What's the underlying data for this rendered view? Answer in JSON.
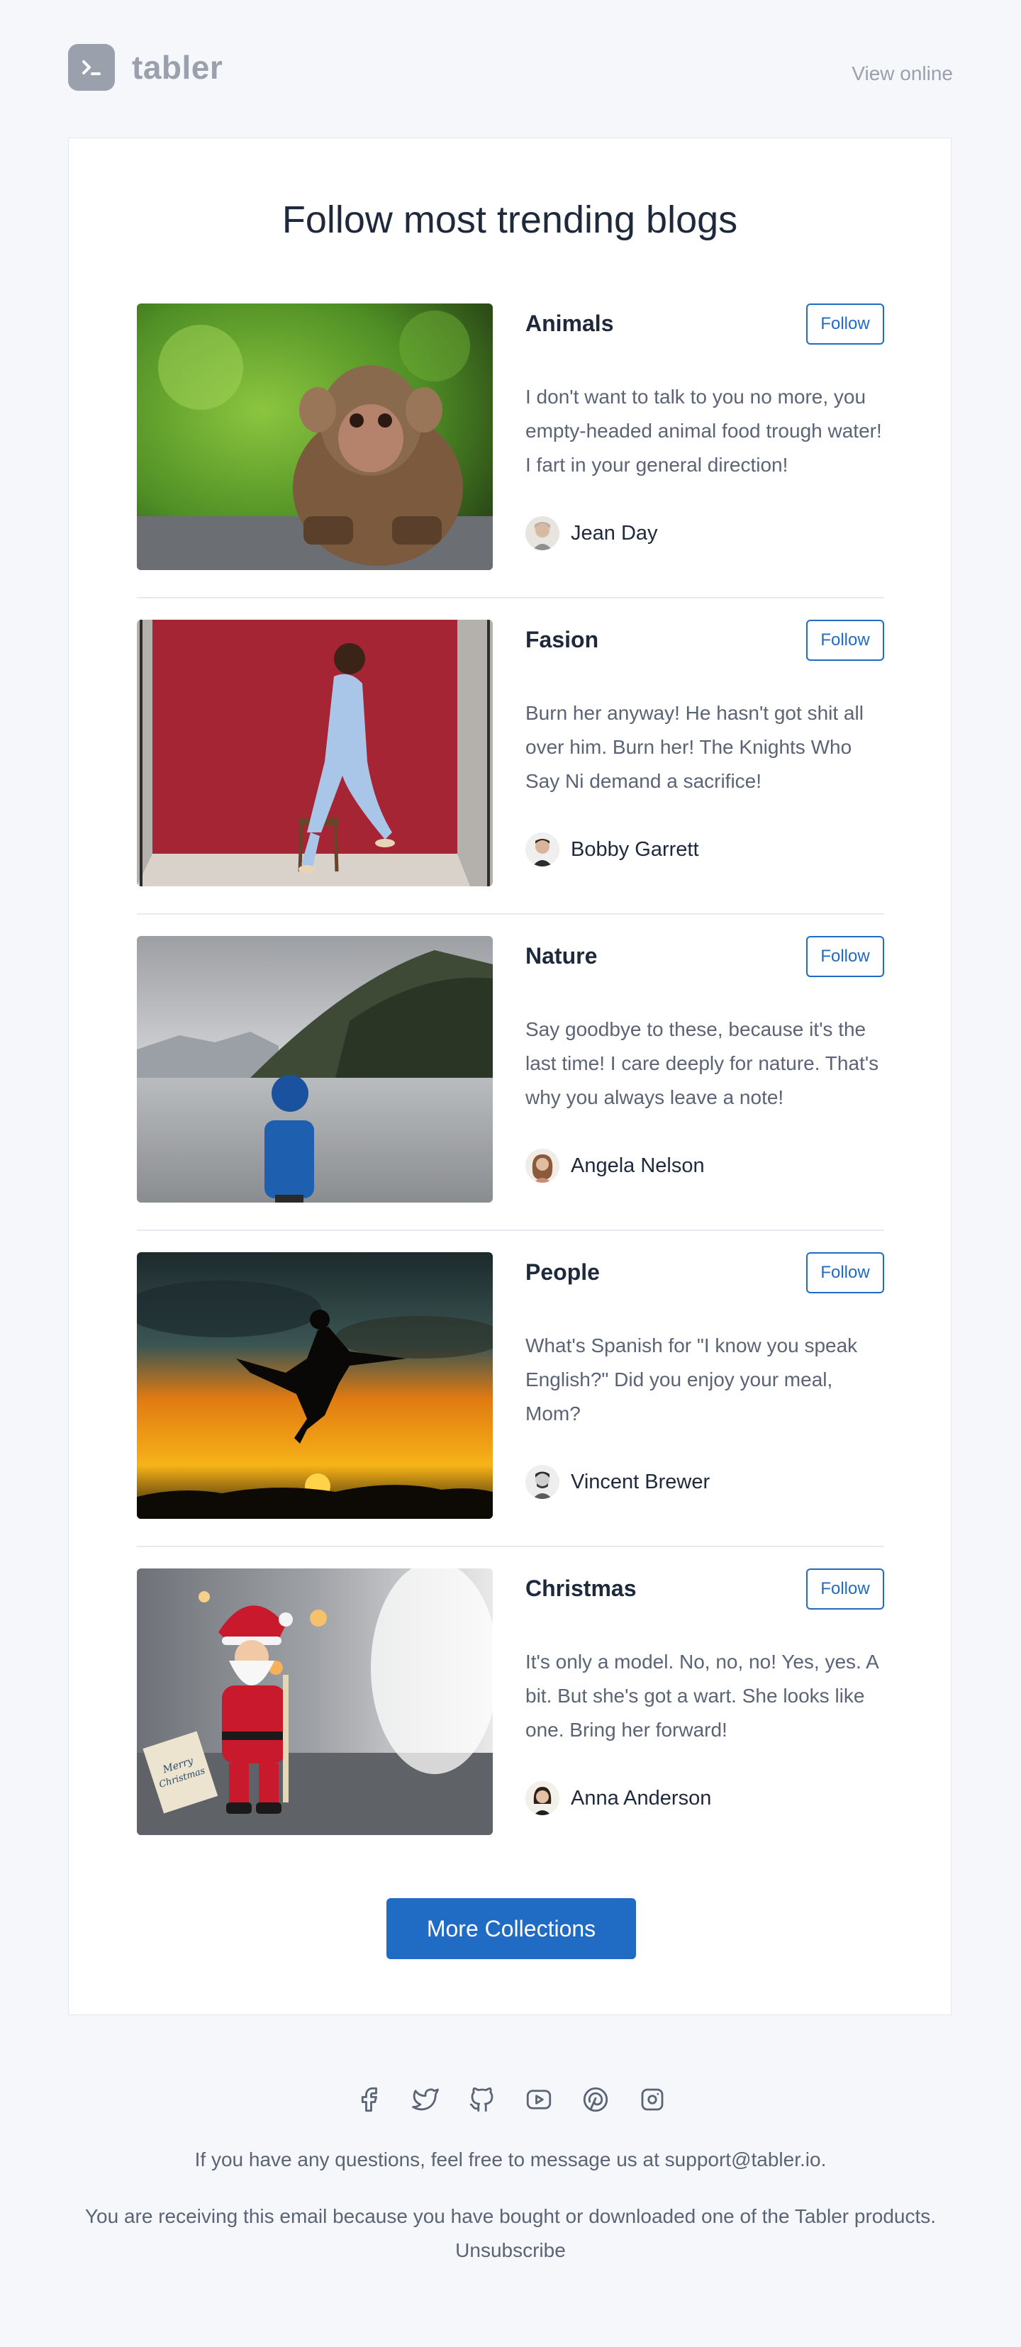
{
  "header": {
    "brand": "tabler",
    "view_online": "View online"
  },
  "main": {
    "title": "Follow most trending blogs",
    "blogs": [
      {
        "title": "Animals",
        "follow_label": "Follow",
        "description": "I don't want to talk to you no more, you empty-headed animal food trough water! I fart in your general direction!",
        "author": "Jean Day",
        "image": "monkey-photo"
      },
      {
        "title": "Fasion",
        "follow_label": "Follow",
        "description": "Burn her anyway! He hasn't got shit all over him. Burn her! The Knights Who Say Ni demand a sacrifice!",
        "author": "Bobby Garrett",
        "image": "fashion-model-photo"
      },
      {
        "title": "Nature",
        "follow_label": "Follow",
        "description": "Say goodbye to these, because it's the last time! I care deeply for nature. That's why you always leave a note!",
        "author": "Angela Nelson",
        "image": "lake-person-photo"
      },
      {
        "title": "People",
        "follow_label": "Follow",
        "description": "What's Spanish for \"I know you speak English?\" Did you enjoy your meal, Mom?",
        "author": "Vincent Brewer",
        "image": "sunset-kick-photo"
      },
      {
        "title": "Christmas",
        "follow_label": "Follow",
        "description": "It's only a model. No, no, no! Yes, yes. A bit. But she's got a wart. She looks like one. Bring her forward!",
        "author": "Anna Anderson",
        "image": "santa-figure-photo",
        "image_text": "Merry Christmas"
      }
    ],
    "more_label": "More Collections"
  },
  "footer": {
    "social_icons": [
      "facebook-icon",
      "twitter-icon",
      "github-icon",
      "youtube-icon",
      "pinterest-icon",
      "instagram-icon"
    ],
    "contact_text": "If you have any questions, feel free to message us at support@tabler.io.",
    "receiving_text": "You are receiving this email because you have bought or downloaded one of the Tabler products.",
    "unsubscribe_label": "Unsubscribe"
  },
  "colors": {
    "accent": "#206bc4",
    "background": "#f5f7fb",
    "muted": "#9aa0ac"
  }
}
